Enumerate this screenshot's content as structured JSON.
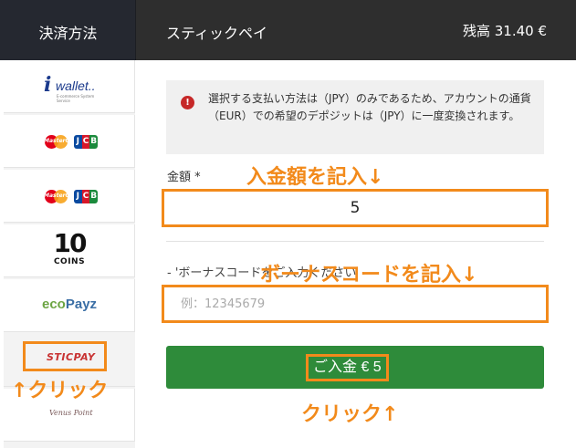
{
  "header": {
    "payment_methods_label": "決済方法",
    "method_title": "スティックペイ",
    "balance": "残高 31.40 €"
  },
  "sidebar": {
    "items": [
      {
        "name": "iwallet",
        "logo_text_1": "i",
        "logo_text_2": "wallet..",
        "logo_sub": "E-commerce System Service"
      },
      {
        "name": "mastercard-jcb-1",
        "mc_text": "MasterCard",
        "jcb_text": "JCB"
      },
      {
        "name": "mastercard-jcb-2",
        "mc_text": "MasterCard",
        "jcb_text": "JCB"
      },
      {
        "name": "10coins",
        "logo_big": "10",
        "logo_small": "COINS"
      },
      {
        "name": "ecopayz",
        "logo_text_1": "eco",
        "logo_text_2": "Payz"
      },
      {
        "name": "sticpay",
        "logo_text": "STICPAY",
        "selected": true
      },
      {
        "name": "venuspoint",
        "logo_text": "Venus Point"
      }
    ]
  },
  "notice": {
    "icon": "!",
    "text": "選択する支払い方法は（JPY）のみであるため、アカウントの通貨（EUR）での希望のデポジットは（JPY）に一度変換されます。"
  },
  "form": {
    "amount_label": "金額 *",
    "amount_value": "5",
    "bonus_label": "- 'ボーナスコードをご入力ください",
    "bonus_placeholder": "例：12345679",
    "deposit_button_label": "ご入金 € 5"
  },
  "annotations": {
    "amount_note": "入金額を記入↓",
    "bonus_note": "ボーナスコードを記入↓",
    "sticpay_note": "↑クリック",
    "deposit_note": "クリック↑"
  },
  "colors": {
    "header_bg": "#2e2e2e",
    "accent_orange": "#f28a1b",
    "button_green": "#2e8b3a",
    "notice_icon_red": "#c62828"
  }
}
